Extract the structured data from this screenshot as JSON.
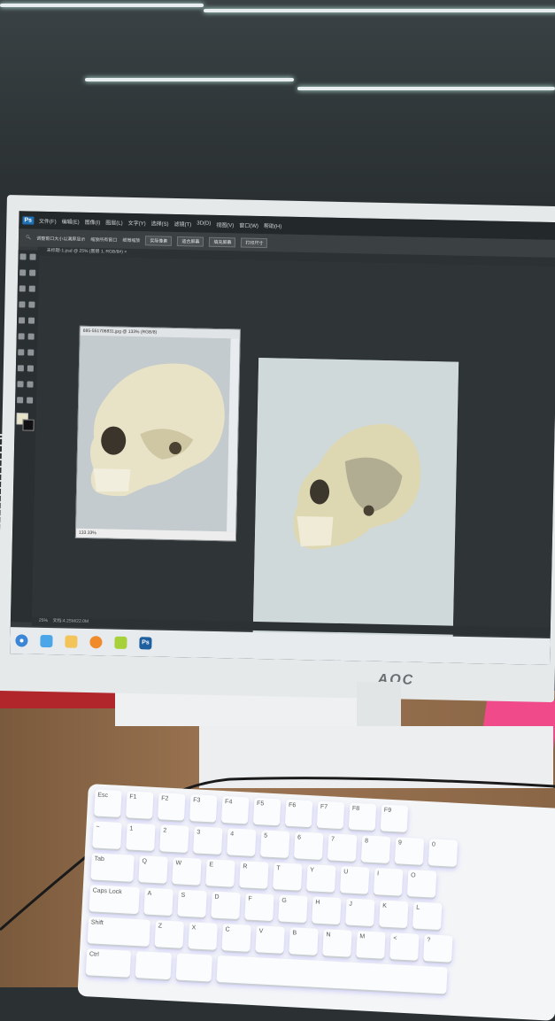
{
  "photoshop": {
    "logo": "Ps",
    "menu": [
      "文件(F)",
      "编辑(E)",
      "图像(I)",
      "图层(L)",
      "文字(Y)",
      "选择(S)",
      "滤镜(T)",
      "3D(D)",
      "视图(V)",
      "窗口(W)",
      "帮助(H)"
    ],
    "options": {
      "checkbox1": "调整窗口大小以满屏显示",
      "checkbox2": "缩放所有窗口",
      "checkbox3": "细微缩放",
      "buttons": [
        "实际像素",
        "适合屏幕",
        "填充屏幕",
        "打印尺寸"
      ]
    },
    "tab_label": "未标题-1.psd @ 25% (图层 1, RGB/8#) ×",
    "doc_window": {
      "title": "695-551706831.jpg @ 133% (RGB/8)",
      "status": "133.33%"
    },
    "status_bar": {
      "zoom": "25%",
      "doc": "文档:4.25M/22.0M"
    }
  },
  "monitor": {
    "brand": "AOC"
  },
  "taskbar": {
    "app_label": "Ps"
  },
  "keyboard": {
    "row1": [
      "Esc",
      "F1",
      "F2",
      "F3",
      "F4",
      "F5",
      "F6",
      "F7",
      "F8",
      "F9"
    ],
    "row2": [
      "~",
      "1",
      "2",
      "3",
      "4",
      "5",
      "6",
      "7",
      "8",
      "9",
      "0"
    ],
    "row3": [
      "Tab",
      "Q",
      "W",
      "E",
      "R",
      "T",
      "Y",
      "U",
      "I",
      "O"
    ],
    "row4": [
      "Caps Lock",
      "A",
      "S",
      "D",
      "F",
      "G",
      "H",
      "J",
      "K",
      "L"
    ],
    "row5": [
      "Shift",
      "Z",
      "X",
      "C",
      "V",
      "B",
      "N",
      "M",
      "<",
      "?"
    ],
    "row6": [
      "Ctrl",
      "",
      ""
    ]
  }
}
